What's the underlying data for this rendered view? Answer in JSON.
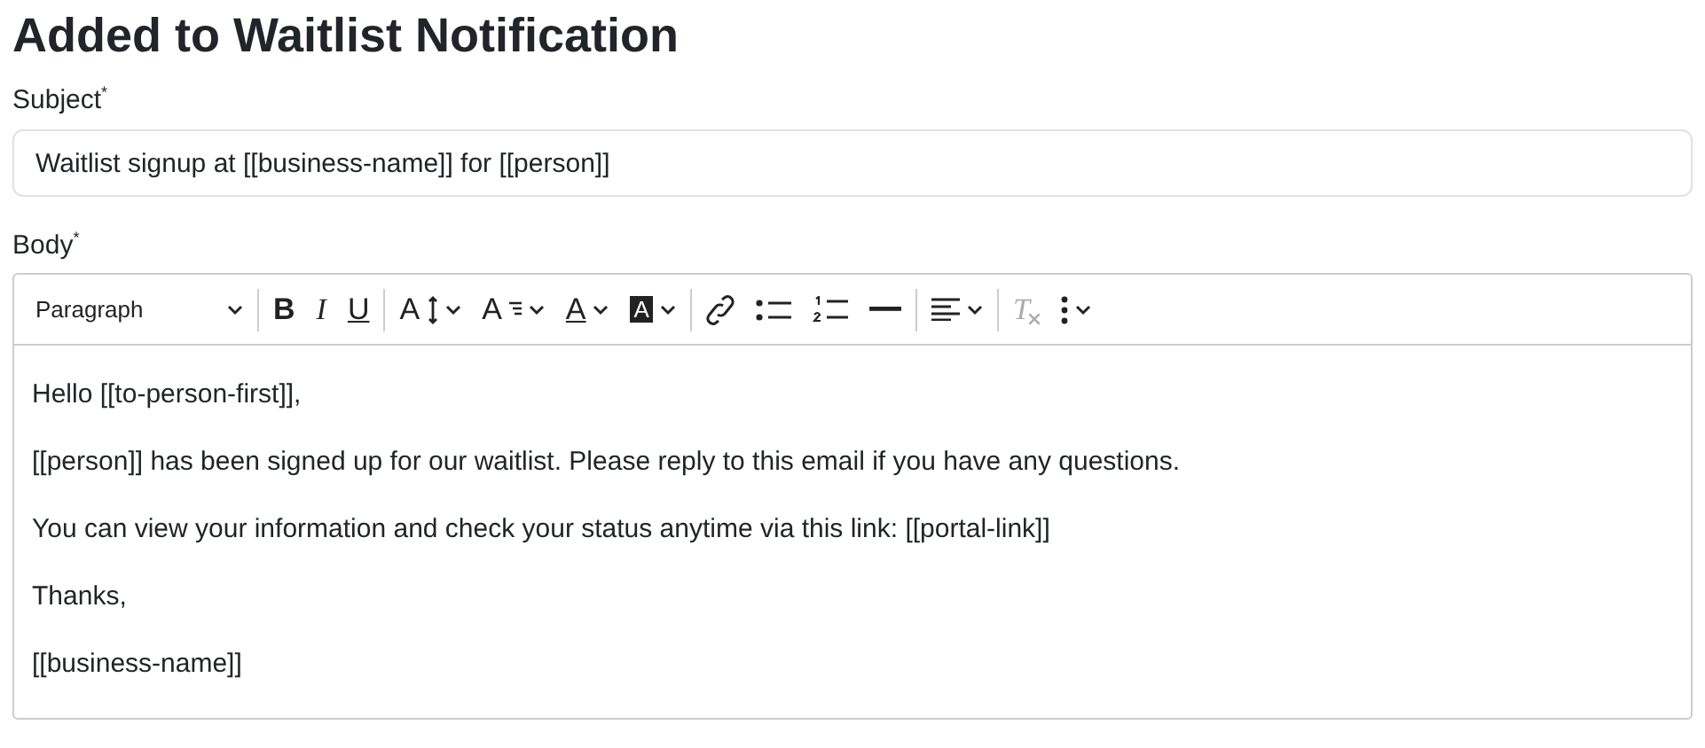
{
  "title": "Added to Waitlist Notification",
  "subject": {
    "label": "Subject",
    "required_mark": "*",
    "value": "Waitlist signup at [[business-name]] for [[person]]"
  },
  "body": {
    "label": "Body",
    "required_mark": "*",
    "toolbar": [
      {
        "kind": "block",
        "label": "Paragraph",
        "disabled": false
      },
      {
        "kind": "sep"
      },
      {
        "kind": "bold",
        "glyph": "B",
        "disabled": false
      },
      {
        "kind": "italic",
        "glyph": "I",
        "disabled": false
      },
      {
        "kind": "underline",
        "glyph": "U",
        "disabled": false
      },
      {
        "kind": "sep"
      },
      {
        "kind": "fontsize",
        "glyph": "A",
        "disabled": false
      },
      {
        "kind": "lineheight",
        "glyph": "A",
        "disabled": false
      },
      {
        "kind": "forecolor",
        "glyph": "A",
        "disabled": false
      },
      {
        "kind": "backcolor",
        "glyph": "A",
        "disabled": false
      },
      {
        "kind": "sep"
      },
      {
        "kind": "link",
        "disabled": false
      },
      {
        "kind": "bullist",
        "disabled": false
      },
      {
        "kind": "numlist",
        "disabled": false
      },
      {
        "kind": "hr",
        "disabled": false
      },
      {
        "kind": "sep"
      },
      {
        "kind": "align",
        "disabled": false
      },
      {
        "kind": "sep"
      },
      {
        "kind": "clear",
        "glyph": "T",
        "disabled": true
      },
      {
        "kind": "more",
        "disabled": false
      }
    ],
    "paragraphs": [
      "Hello [[to-person-first]],",
      "[[person]] has been signed up for our waitlist. Please reply to this email if you have any questions.",
      "You can view your information and check your status anytime via this link: [[portal-link]]",
      "Thanks,",
      "[[business-name]]"
    ]
  }
}
